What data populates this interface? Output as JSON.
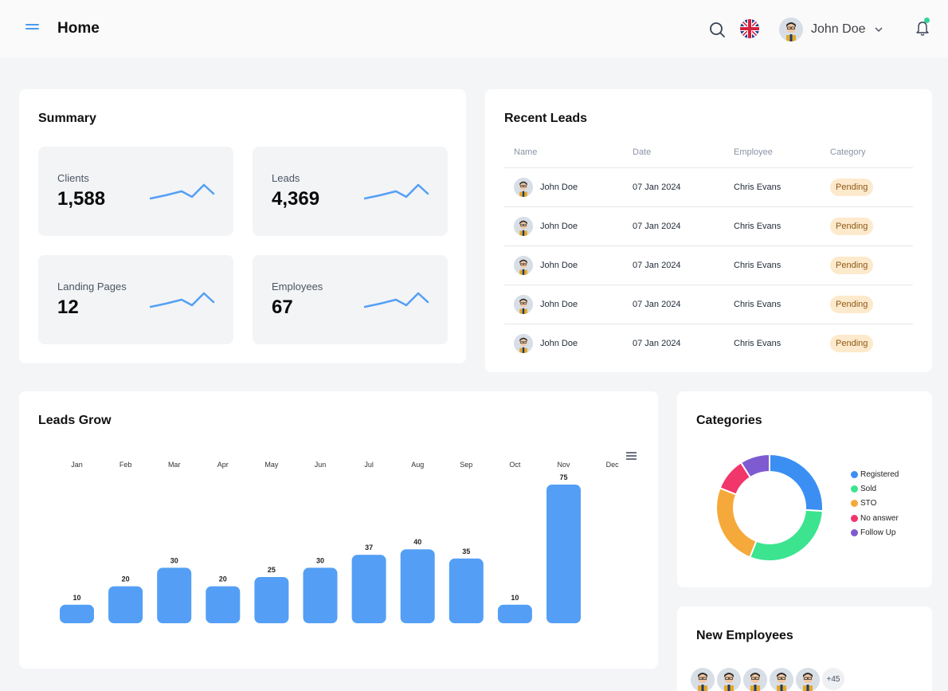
{
  "header": {
    "title": "Home",
    "user_name": "John Doe"
  },
  "summary": {
    "title": "Summary",
    "stats": [
      {
        "label": "Clients",
        "value": "1,588"
      },
      {
        "label": "Leads",
        "value": "4,369"
      },
      {
        "label": "Landing Pages",
        "value": "12"
      },
      {
        "label": "Employees",
        "value": "67"
      }
    ]
  },
  "recent_leads": {
    "title": "Recent Leads",
    "columns": [
      "Name",
      "Date",
      "Employee",
      "Category"
    ],
    "rows": [
      {
        "name": "John Doe",
        "date": "07 Jan 2024",
        "employee": "Chris Evans",
        "category": "Pending"
      },
      {
        "name": "John Doe",
        "date": "07 Jan 2024",
        "employee": "Chris Evans",
        "category": "Pending"
      },
      {
        "name": "John Doe",
        "date": "07 Jan 2024",
        "employee": "Chris Evans",
        "category": "Pending"
      },
      {
        "name": "John Doe",
        "date": "07 Jan 2024",
        "employee": "Chris Evans",
        "category": "Pending"
      },
      {
        "name": "John Doe",
        "date": "07 Jan 2024",
        "employee": "Chris Evans",
        "category": "Pending"
      }
    ]
  },
  "leads_grow": {
    "title": "Leads Grow"
  },
  "categories_card": {
    "title": "Categories"
  },
  "new_employees": {
    "title": "New Employees",
    "more_count": "+45"
  },
  "colors": {
    "accent": "#4b9af1",
    "bar": "#549ff5",
    "badge_bg": "#fde9cc",
    "online_dot": "#34d399"
  },
  "chart_data": [
    {
      "type": "bar",
      "title": "",
      "categories": [
        "Jan",
        "Feb",
        "Mar",
        "Apr",
        "May",
        "Jun",
        "Jul",
        "Aug",
        "Sep",
        "Oct",
        "Nov",
        "Dec"
      ],
      "values": [
        10,
        20,
        30,
        20,
        25,
        30,
        37,
        40,
        35,
        10,
        75,
        null
      ],
      "xlabel": "",
      "ylabel": "",
      "x_axis_position": "top",
      "ylim": [
        0,
        75
      ],
      "grid": false,
      "data_labels": true
    },
    {
      "type": "pie",
      "variant": "donut",
      "labels": [
        "Registered",
        "Sold",
        "STO",
        "No answer",
        "Follow Up"
      ],
      "values": [
        26,
        30,
        25,
        10,
        9
      ],
      "colors": [
        "#3b8ff3",
        "#3ce48f",
        "#f5a93a",
        "#f1366b",
        "#7e5bd0"
      ],
      "legend": "right"
    }
  ]
}
